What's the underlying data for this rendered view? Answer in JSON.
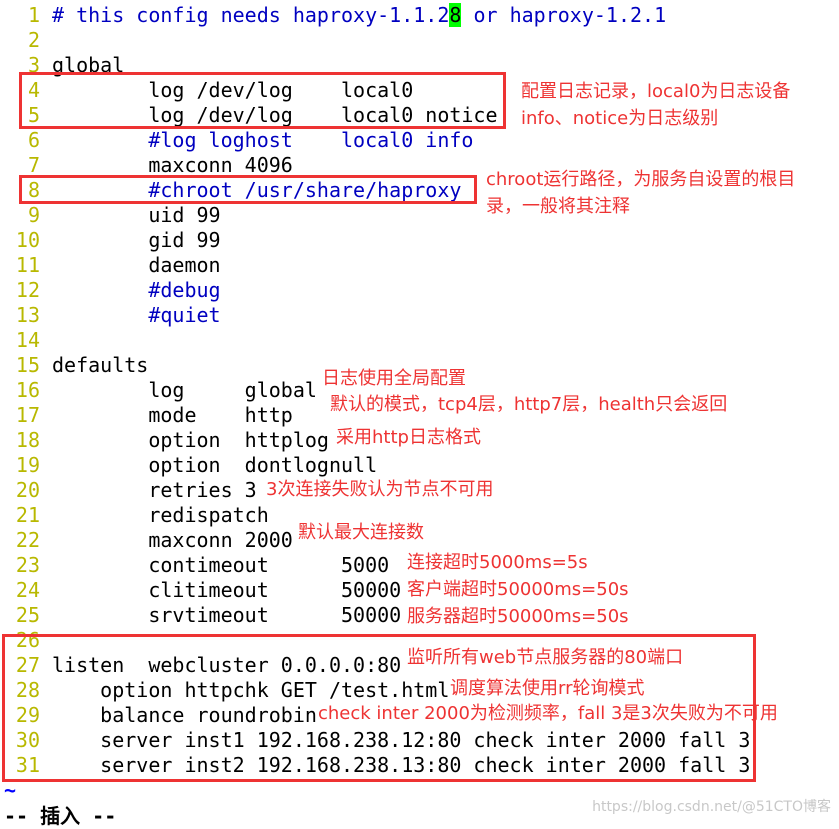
{
  "editor": {
    "lines": [
      {
        "n": "1",
        "pre": "# this config needs haproxy-1.1.2",
        "cursor": "8",
        "post": " or haproxy-1.2.1",
        "kind": "comment"
      },
      {
        "n": "2",
        "text": "",
        "kind": "normal"
      },
      {
        "n": "3",
        "text": "global",
        "kind": "normal"
      },
      {
        "n": "4",
        "text": "        log /dev/log    local0",
        "kind": "normal"
      },
      {
        "n": "5",
        "text": "        log /dev/log    local0 notice",
        "kind": "normal"
      },
      {
        "n": "6",
        "text": "        #log loghost    local0 info",
        "kind": "comment"
      },
      {
        "n": "7",
        "text": "        maxconn 4096",
        "kind": "normal"
      },
      {
        "n": "8",
        "text": "        #chroot /usr/share/haproxy",
        "kind": "comment"
      },
      {
        "n": "9",
        "text": "        uid 99",
        "kind": "normal"
      },
      {
        "n": "10",
        "text": "        gid 99",
        "kind": "normal"
      },
      {
        "n": "11",
        "text": "        daemon",
        "kind": "normal"
      },
      {
        "n": "12",
        "text": "        #debug",
        "kind": "comment"
      },
      {
        "n": "13",
        "text": "        #quiet",
        "kind": "comment"
      },
      {
        "n": "14",
        "text": "",
        "kind": "normal"
      },
      {
        "n": "15",
        "text": "defaults",
        "kind": "normal"
      },
      {
        "n": "16",
        "text": "        log     global",
        "kind": "normal"
      },
      {
        "n": "17",
        "text": "        mode    http",
        "kind": "normal"
      },
      {
        "n": "18",
        "text": "        option  httplog",
        "kind": "normal"
      },
      {
        "n": "19",
        "text": "        option  dontlognull",
        "kind": "normal"
      },
      {
        "n": "20",
        "text": "        retries 3",
        "kind": "normal"
      },
      {
        "n": "21",
        "text": "        redispatch",
        "kind": "normal"
      },
      {
        "n": "22",
        "text": "        maxconn 2000",
        "kind": "normal"
      },
      {
        "n": "23",
        "text": "        contimeout      5000",
        "kind": "normal"
      },
      {
        "n": "24",
        "text": "        clitimeout      50000",
        "kind": "normal"
      },
      {
        "n": "25",
        "text": "        srvtimeout      50000",
        "kind": "normal"
      },
      {
        "n": "26",
        "text": "",
        "kind": "normal"
      },
      {
        "n": "27",
        "text": "listen  webcluster 0.0.0.0:80",
        "kind": "normal"
      },
      {
        "n": "28",
        "text": "    option httpchk GET /test.html",
        "kind": "normal"
      },
      {
        "n": "29",
        "text": "    balance roundrobin",
        "kind": "normal"
      },
      {
        "n": "30",
        "text": "    server inst1 192.168.238.12:80 check inter 2000 fall 3",
        "kind": "normal"
      },
      {
        "n": "31",
        "text": "    server inst2 192.168.238.13:80 check inter 2000 fall 3",
        "kind": "normal"
      }
    ],
    "tilde": "~",
    "status": "-- 插入 --"
  },
  "annotations": {
    "log_config": [
      "配置日志记录，local0为日志设备",
      "info、notice为日志级别"
    ],
    "chroot": [
      "chroot运行路径，为服务自设置的根目",
      "录，一般将其注释"
    ],
    "log_global": "日志使用全局配置",
    "mode": "默认的模式，tcp4层，http7层，health只会返回",
    "httplog": "采用http日志格式",
    "retries": "3次连接失败认为节点不可用",
    "maxconn": "默认最大连接数",
    "contimeout": "连接超时5000ms=5s",
    "clitimeout": "客户端超时50000ms=50s",
    "srvtimeout": "服务器超时50000ms=50s",
    "listen": "监听所有web节点服务器的80端口",
    "httpchk": "调度算法使用rr轮询模式",
    "check": "check inter 2000为检测频率，fall 3是3次失败为不可用"
  },
  "watermark": "https://blog.csdn.net/@51CTO博客",
  "colors": {
    "line_number": "#b8b800",
    "comment": "#0000c0",
    "annotation": "#ee3333",
    "cursor": "#00ff00"
  }
}
